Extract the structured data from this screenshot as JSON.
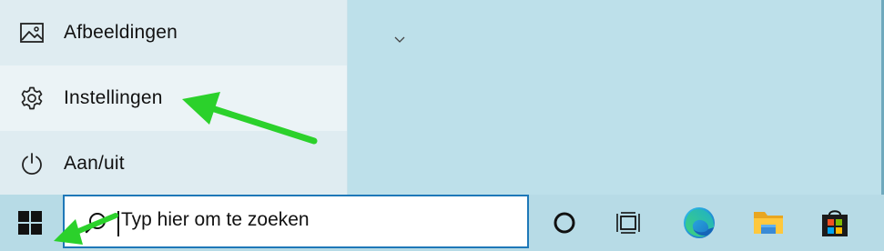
{
  "start_menu": {
    "items": [
      {
        "label": "Afbeeldingen",
        "icon": "pictures-icon"
      },
      {
        "label": "Instellingen",
        "icon": "gear-icon"
      },
      {
        "label": "Aan/uit",
        "icon": "power-icon"
      }
    ]
  },
  "taskbar": {
    "search": {
      "placeholder": "Typ hier om te zoeken"
    },
    "icons": [
      {
        "name": "cortana-icon"
      },
      {
        "name": "task-view-icon"
      },
      {
        "name": "edge-icon"
      },
      {
        "name": "file-explorer-icon"
      },
      {
        "name": "store-icon"
      }
    ]
  },
  "annotations": {
    "arrow_color": "#2bd12b"
  },
  "colors": {
    "accent": "#1e78b8",
    "menu_bg": "#dfecf1",
    "hover_bg": "#ebf3f6",
    "desktop_bg": "#b9dde8"
  }
}
